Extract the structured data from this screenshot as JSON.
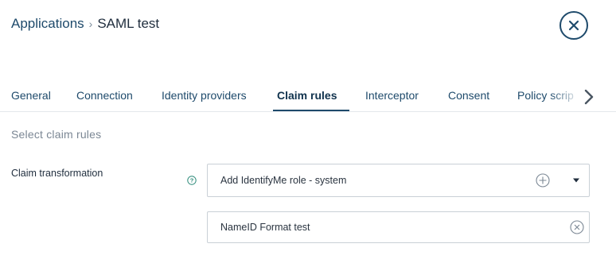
{
  "breadcrumb": {
    "parent": "Applications",
    "separator": "›",
    "current": "SAML test"
  },
  "header": {
    "close_icon": "close-icon"
  },
  "tabs": [
    {
      "label": "General"
    },
    {
      "label": "Connection"
    },
    {
      "label": "Identity providers"
    },
    {
      "label": "Claim rules",
      "active": true
    },
    {
      "label": "Interceptor"
    },
    {
      "label": "Consent"
    },
    {
      "label": "Policy scrip"
    }
  ],
  "main": {
    "section_title": "Select claim rules",
    "claim_transformation": {
      "label": "Claim transformation",
      "select_value": "Add IdentifyMe role - system",
      "selected_items": [
        "NameID Format test"
      ]
    }
  },
  "colors": {
    "accent": "#1e4a6b",
    "border": "#c9d0d6",
    "muted": "#7b8794"
  }
}
